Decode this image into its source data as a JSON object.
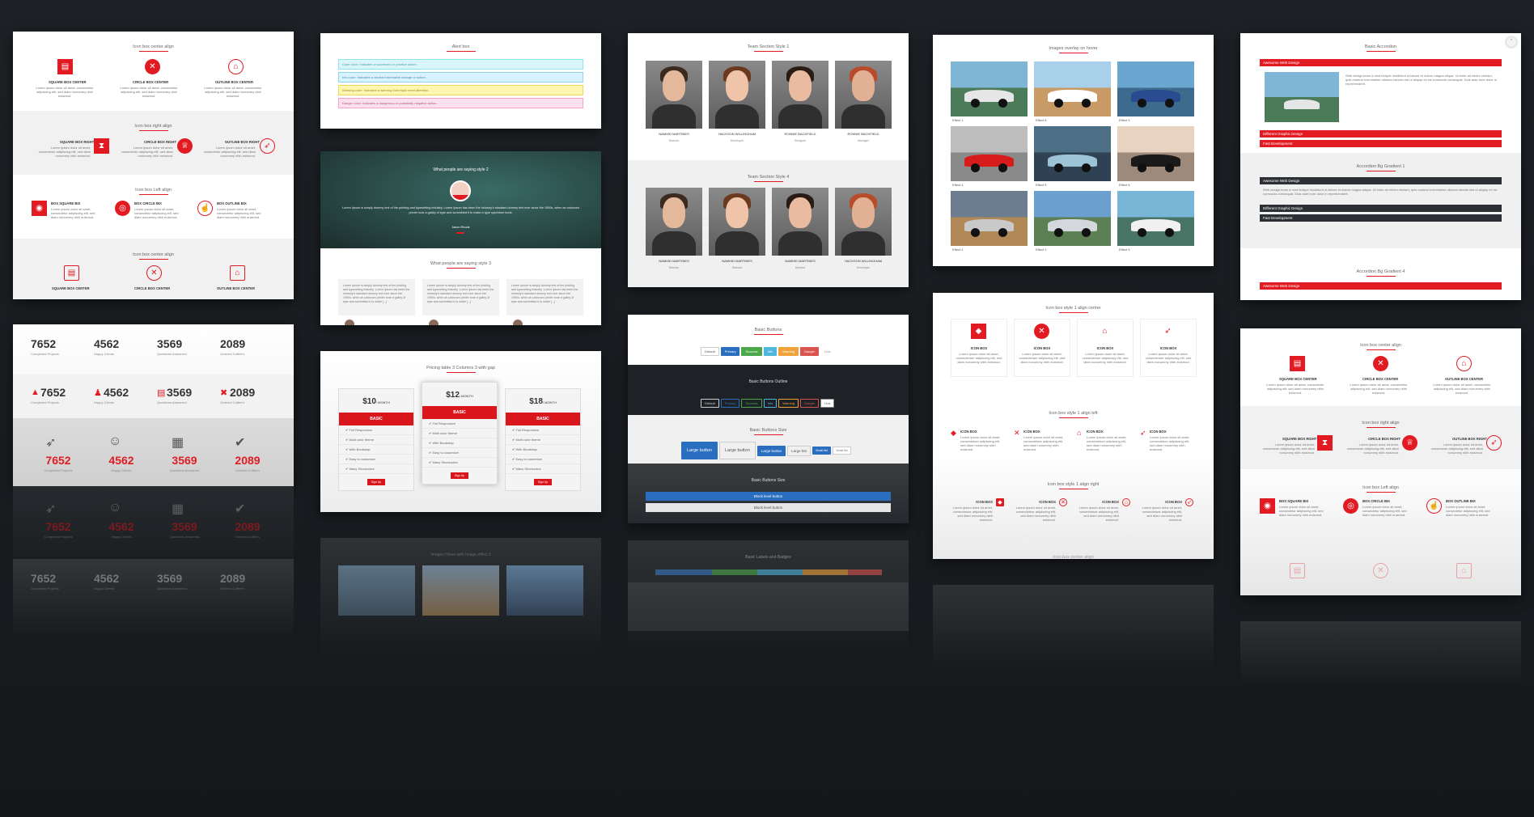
{
  "colors": {
    "accent": "#e21b23",
    "background": "#1a1e21",
    "dark_section": "#1e2227"
  },
  "icon_boxes": {
    "c1s1_title": "Icon box center align",
    "c1s1_items": [
      {
        "label": "SQUARE BOX CENTER",
        "icon": "chart-icon"
      },
      {
        "label": "CIRCLE BOX CENTER",
        "icon": "close-icon"
      },
      {
        "label": "OUTLINE BOX CENTER",
        "icon": "bank-icon"
      }
    ],
    "c1s2_title": "Icon box right align",
    "c1s2_items": [
      {
        "label": "SQUARE BOX RIGHT",
        "icon": "hourglass-icon"
      },
      {
        "label": "CIRCLE BOX RIGHT",
        "icon": "trophy-icon"
      },
      {
        "label": "OUTLINE BOX RIGHT",
        "icon": "rocket-icon"
      }
    ],
    "c1s3_title": "Icon box Left align",
    "c1s3_items": [
      {
        "label": "BOX SQUARE BIX",
        "icon": "user-icon"
      },
      {
        "label": "BOX CIRCLE BIX",
        "icon": "eye-icon"
      },
      {
        "label": "BOX OUTLINE BIX",
        "icon": "thumbs-up-icon"
      }
    ],
    "c1s4_title": "Icon box center align",
    "c1s4_items": [
      "SQUARE BOX CENTER",
      "CIRCLE BOX CENTER",
      "OUTLINE BOX CENTER"
    ],
    "body": "Lorem ipsum dolor sit amet, consectetur adipiscing elit, sed diam nonummy nibh euismod."
  },
  "alerts": {
    "title": "Alert box",
    "items": [
      {
        "text": "Cyan color: Indicates a successful or positive action.",
        "bg": "#d9f7fa",
        "border": "#8fe3ec"
      },
      {
        "text": "Info color: Indicates a neutral informative change or action.",
        "bg": "#d6f3ff",
        "border": "#8fd3ef"
      },
      {
        "text": "Warning color: Indicates a warning that might need attention.",
        "bg": "#fff7b0",
        "border": "#ecd860"
      },
      {
        "text": "Danger color: Indicates a dangerous or potentially negative action.",
        "bg": "#ffe0ee",
        "border": "#f4a3c4"
      }
    ]
  },
  "testimonials": {
    "title2": "What people are saying style 2",
    "quote": "Lorem Ipsum is simply dummy text of the printing and typesetting industry. Lorem Ipsum has been the industry's standard dummy text ever since the 1500s, when an unknown printer took a galley of type and scrambled it to make a type specimen book.",
    "name": "Jason Rhode",
    "title3": "What people are saying style 3",
    "card_text": "Lorem Ipsum is simply dummy text of the printing and typesetting industry. Lorem Ipsum has been the industry's standard dummy text ever since the 1500s. when an unknown printer took a galley of type and scrambled it to make [...]"
  },
  "team": {
    "title1": "Team Section Style 1",
    "row1": [
      {
        "name": "NAMHID MARTINES",
        "role": "Director"
      },
      {
        "name": "HACKSON WILLINGHAM",
        "role": "Developer"
      },
      {
        "name": "RONNIE BACKFIELD",
        "role": "Designer"
      },
      {
        "name": "RONNIE BACKFIELD",
        "role": "Manager"
      }
    ],
    "title4": "Team Section Style 4",
    "row2": [
      {
        "name": "NAMHID MARTINES",
        "role": "Director"
      },
      {
        "name": "NAMHID MARTINES",
        "role": "Director"
      },
      {
        "name": "NAMHID MARTINES",
        "role": "Director"
      },
      {
        "name": "HACKSON WILLINGHAM",
        "role": "Developer"
      }
    ]
  },
  "gallery": {
    "title": "Images overlay on hover",
    "items": [
      {
        "label": "Effect 1",
        "sky": "#7fb6d6",
        "ground": "#4c7b5a",
        "car": "#e6e6e6"
      },
      {
        "label": "Effect 8",
        "sky": "#a9d0ea",
        "ground": "#c89a66",
        "car": "#ffffff"
      },
      {
        "label": "Effect 3",
        "sky": "#6aa6cf",
        "ground": "#3d6b8d",
        "car": "#2a4b8f"
      },
      {
        "label": "Effect 4",
        "sky": "#bdbdbd",
        "ground": "#8a8a8a",
        "car": "#d81c1c"
      },
      {
        "label": "Effect 5",
        "sky": "#4d6f85",
        "ground": "#2e4254",
        "car": "#9cc3d6"
      },
      {
        "label": "Effect 6",
        "sky": "#e8d3c1",
        "ground": "#9e8a7a",
        "car": "#1a1a1a"
      },
      {
        "label": "Effect 2",
        "sky": "#6c7d8f",
        "ground": "#b08855",
        "car": "#c9c9c9"
      },
      {
        "label": "Effect 2",
        "sky": "#6b9fd0",
        "ground": "#5d7f54",
        "car": "#d4d8dc"
      },
      {
        "label": "Effect 9",
        "sky": "#78b6d8",
        "ground": "#487565",
        "car": "#f0f0f0"
      }
    ]
  },
  "accordion": {
    "title1": "Basic Accordion",
    "a1": "Awesome Web Design",
    "a2": "Different Graphic Design",
    "a3": "Fast Development",
    "body": "Web design team a mod tempor incididunt ut labore et dolore magna aliqua. Ut enim ad minim veniam, quis nostrud exercitation ullamco laboris nisi ut aliquip ex ea commodo consequat. Duis aute irure dolor in reprehenderit.",
    "title2": "Accordion Bg Gradient 1",
    "title3": "Accordion Bg Gradient 4"
  },
  "counters": {
    "values": [
      "7652",
      "4562",
      "3569",
      "2089"
    ],
    "labels": [
      "Completed Projects",
      "Happy Clients",
      "Questions Answered",
      "Ordered Coffee's"
    ]
  },
  "pricing": {
    "title": "Pricing table 3 Columns 3 with gap",
    "plans": [
      {
        "price": "$10",
        "period": "/ MONTH",
        "name": "BASIC"
      },
      {
        "price": "$12",
        "period": "/ MONTH",
        "name": "BASIC"
      },
      {
        "price": "$18",
        "period": "/ MONTH",
        "name": "BASIC"
      }
    ],
    "features": [
      "Full Responsive",
      "Multi color theme",
      "With Bootstrap",
      "Easy to customize",
      "Many Shortcodes"
    ],
    "signup": "Sign Up"
  },
  "buttons": {
    "title1": "Basic Buttons",
    "basic": [
      {
        "label": "Default",
        "bg": "#ffffff",
        "fg": "#555"
      },
      {
        "label": "Primary",
        "bg": "#2a6ebf",
        "fg": "#fff"
      },
      {
        "label": "Success",
        "bg": "#4ba94b",
        "fg": "#fff"
      },
      {
        "label": "Info",
        "bg": "#4fb7dd",
        "fg": "#fff"
      },
      {
        "label": "Warning",
        "bg": "#f0a33a",
        "fg": "#fff"
      },
      {
        "label": "Danger",
        "bg": "#d9534f",
        "fg": "#fff"
      },
      {
        "label": "Link",
        "bg": "transparent",
        "fg": "#888"
      }
    ],
    "title2": "Basic Buttons Outline",
    "outline": [
      "Default",
      "Primary",
      "Success",
      "Info",
      "Warning",
      "Danger",
      "Link"
    ],
    "title3": "Basic Buttons Size",
    "sizes": [
      "Large button",
      "Large button",
      "Large button",
      "Large btn",
      "Small btn",
      "Small btn"
    ],
    "title4": "Basic Buttons Size",
    "block": [
      "Block level button",
      "Block level button"
    ]
  },
  "icon_boxes2": {
    "title1": "Icon box style 1 align center",
    "label": "ICON BOX",
    "title2": "Icon box style 1 align left",
    "title3": "Icon box style 1 align right",
    "body": "Lorem ipsum dolor sit amet, consectetuer adipiscing elit, sed diam nonummy nibh euismod."
  },
  "icon_boxes3": {
    "title1": "Icon box center align",
    "title2": "Icon box right align",
    "title3": "Icon box Left align"
  },
  "refl": {
    "gallery_title": "Images Hover with Image effect 3",
    "tags_title": "Basic Labels and Badges"
  }
}
